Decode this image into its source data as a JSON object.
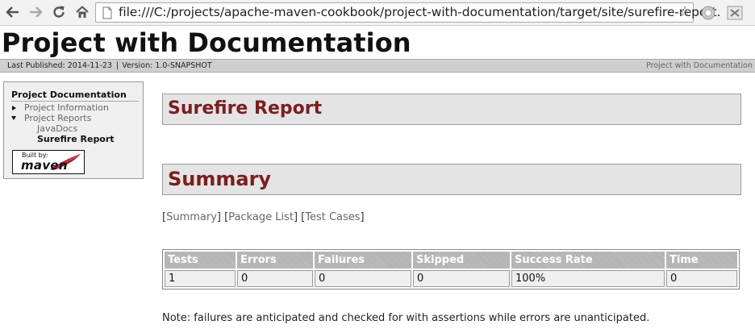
{
  "browser": {
    "back_icon": "arrow-left-icon",
    "forward_icon": "arrow-right-icon",
    "reload_icon": "reload-icon",
    "home_icon": "home-icon",
    "url": "file:///C:/projects/apache-maven-cookbook/project-with-documentation/target/site/surefire-report.",
    "bookmark_icon": "star-icon"
  },
  "banner": {
    "title": "Project with Documentation"
  },
  "breadcrumbs": {
    "last_published": "Last Published: 2014-11-23",
    "separator": "|",
    "version": "Version: 1.0-SNAPSHOT",
    "right_link": "Project with Documentation"
  },
  "nav": {
    "heading": "Project Documentation",
    "items": [
      {
        "label": "Project Information"
      },
      {
        "label": "Project Reports"
      },
      {
        "label": "JavaDocs"
      },
      {
        "label": "Surefire Report"
      }
    ],
    "badge_small": "Built by:",
    "badge_big": "maven"
  },
  "main": {
    "report_title": "Surefire Report",
    "summary_title": "Summary",
    "links": {
      "open": "[",
      "summary": "Summary",
      "close_open1": "] [",
      "package_list": "Package List",
      "close_open2": "] [",
      "test_cases": "Test Cases",
      "close": "]"
    },
    "table": {
      "headers": [
        "Tests",
        "Errors",
        "Failures",
        "Skipped",
        "Success Rate",
        "Time"
      ],
      "row": [
        "1",
        "0",
        "0",
        "0",
        "100%",
        "0"
      ]
    },
    "note": "Note: failures are anticipated and checked for with assertions while errors are unanticipated."
  }
}
